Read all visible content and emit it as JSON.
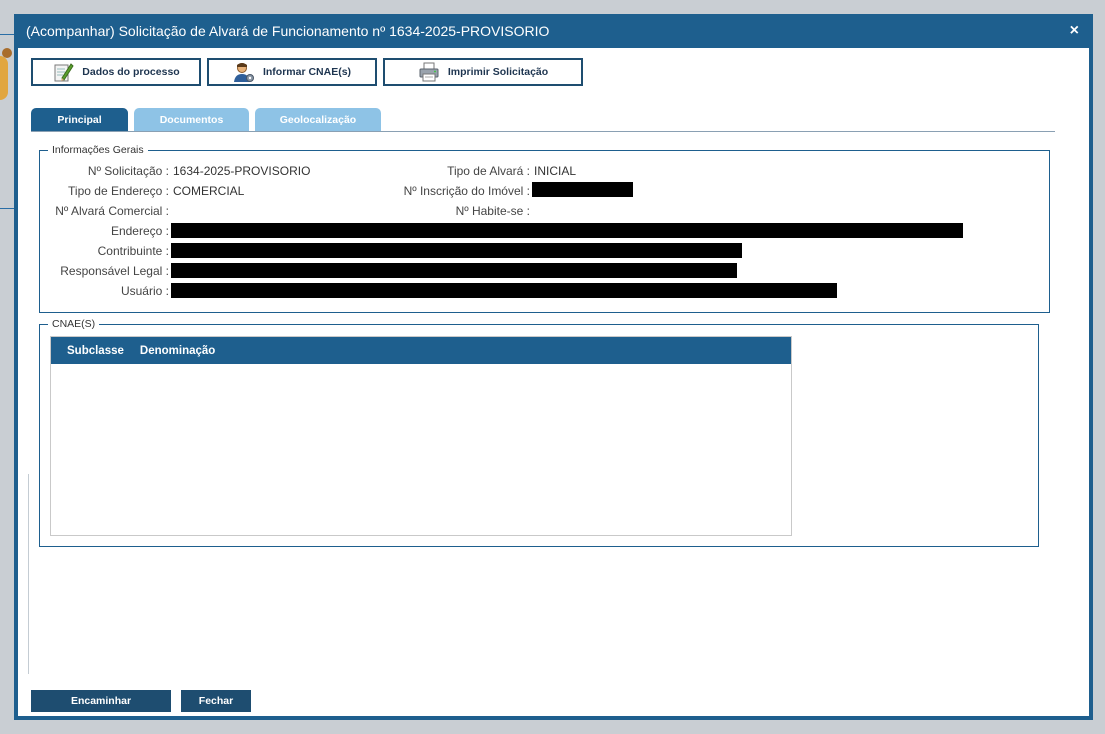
{
  "window": {
    "title": "(Acompanhar) Solicitação de Alvará de Funcionamento nº 1634-2025-PROVISORIO",
    "close_label": "×"
  },
  "toolbar": {
    "dados_label": "Dados do processo",
    "cnae_label": "Informar CNAE(s)",
    "imprimir_label": "Imprimir Solicitação"
  },
  "tabs": [
    {
      "label": "Principal",
      "active": true
    },
    {
      "label": "Documentos",
      "active": false
    },
    {
      "label": "Geolocalização",
      "active": false
    }
  ],
  "info": {
    "legend": "Informações Gerais",
    "fields": {
      "solicitacao_label": "Nº Solicitação :",
      "solicitacao_value": "1634-2025-PROVISORIO",
      "tipo_alvara_label": "Tipo de Alvará :",
      "tipo_alvara_value": "INICIAL",
      "tipo_endereco_label": "Tipo de Endereço :",
      "tipo_endereco_value": "COMERCIAL",
      "inscricao_label": "Nº Inscrição do Imóvel :",
      "alvara_comercial_label": "Nº Alvará Comercial :",
      "habite_label": "Nº Habite-se :",
      "endereco_label": "Endereço :",
      "contribuinte_label": "Contribuinte :",
      "responsavel_label": "Responsável Legal :",
      "usuario_label": "Usuário :"
    }
  },
  "cnae": {
    "legend": "CNAE(S)",
    "columns": [
      "Subclasse",
      "Denominação"
    ]
  },
  "footer": {
    "encaminhar_label": "Encaminhar",
    "fechar_label": "Fechar"
  },
  "colors": {
    "primary": "#1e5f8e",
    "tab_inactive": "#8ec3e6",
    "button_dark": "#1e4d70"
  }
}
